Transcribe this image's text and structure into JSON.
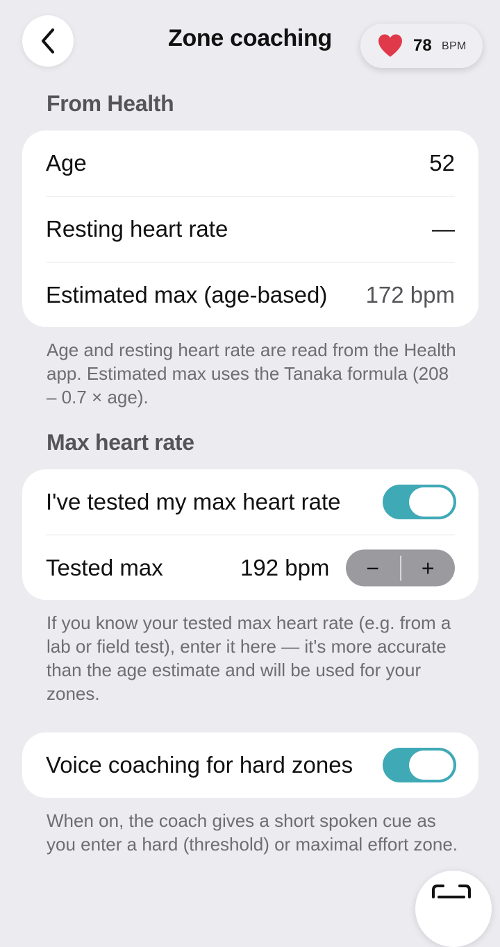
{
  "nav": {
    "title": "Zone coaching",
    "heart_rate": {
      "value": "78",
      "unit": "BPM",
      "icon": "heart-icon",
      "color": "#e03a4a"
    }
  },
  "from_health": {
    "header": "From Health",
    "rows": [
      {
        "label": "Age",
        "value": "52"
      },
      {
        "label": "Resting heart rate",
        "value": "—"
      },
      {
        "label": "Estimated max (age-based)",
        "value": "172 bpm"
      }
    ],
    "footnote": "Age and resting heart rate are read from the Health app. Estimated max uses the Tanaka formula (208 – 0.7 × age)."
  },
  "max_heart_rate": {
    "header": "Max heart rate",
    "tested_toggle": {
      "label": "I've tested my max heart rate",
      "on": true
    },
    "tested_max": {
      "label": "Tested max",
      "value": "192 bpm",
      "decrement": "−",
      "increment": "+"
    },
    "footnote": "If you know your tested max heart rate (e.g. from a lab or field test), enter it here — it's more accurate than the age estimate and will be used for your zones."
  },
  "voice": {
    "toggle": {
      "label": "Voice coaching for hard zones",
      "on": true
    },
    "footnote": "When on, the coach gives a short spoken cue as you enter a hard (threshold) or maximal effort zone."
  },
  "colors": {
    "background": "#ebebf0",
    "card": "#ffffff",
    "toggle_on": "#3fa9b6",
    "secondary_text": "#6d6d72"
  }
}
